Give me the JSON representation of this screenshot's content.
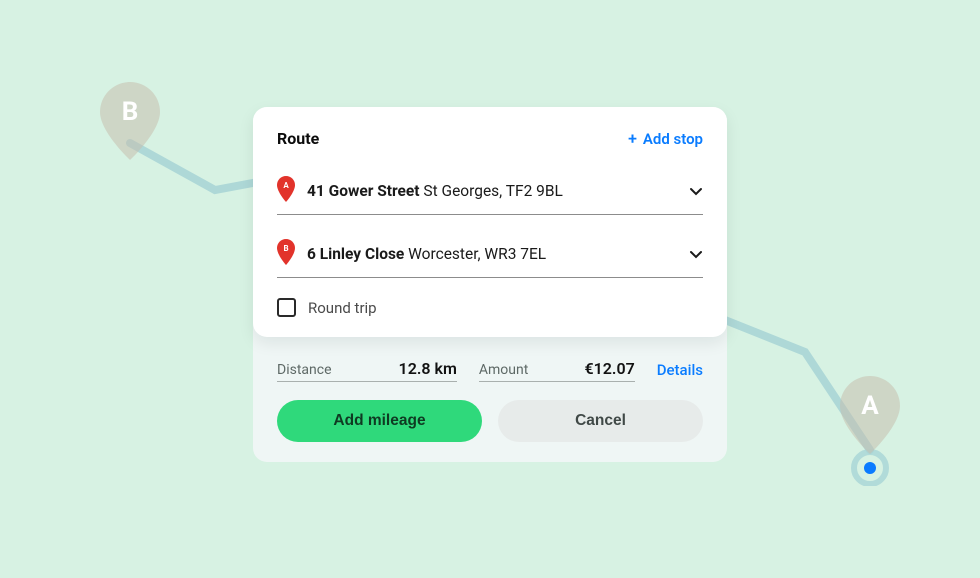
{
  "route_card": {
    "title": "Route",
    "add_stop_label": "Add stop",
    "stops": [
      {
        "marker": "A",
        "address_bold": "41 Gower Street",
        "address_rest": " St Georges, TF2 9BL"
      },
      {
        "marker": "B",
        "address_bold": "6 Linley Close",
        "address_rest": " Worcester, WR3 7EL"
      }
    ],
    "round_trip_label": "Round trip",
    "round_trip_checked": false
  },
  "summary": {
    "distance_label": "Distance",
    "distance_value": "12.8 km",
    "amount_label": "Amount",
    "amount_value": "€12.07",
    "details_label": "Details"
  },
  "buttons": {
    "primary": "Add mileage",
    "secondary": "Cancel"
  },
  "bg_map": {
    "pin_a_label": "A",
    "pin_b_label": "B"
  },
  "colors": {
    "accent_green": "#2fd97b",
    "link_blue": "#0a7cff",
    "pin_red": "#e2332b"
  }
}
